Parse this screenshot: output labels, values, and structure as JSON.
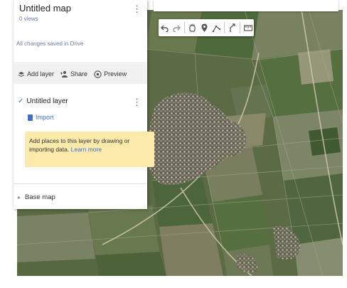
{
  "map": {
    "title": "Untitled map",
    "views": "0 views",
    "save_status": "All changes saved in Drive"
  },
  "actions": {
    "add_layer": "Add layer",
    "share": "Share",
    "preview": "Preview"
  },
  "layer": {
    "name": "Untitled layer",
    "import_label": "Import",
    "hint": "Add places to this layer by drawing or importing data.",
    "learn_more": "Learn more"
  },
  "base_map": {
    "label": "Base map"
  },
  "toolbar": {
    "icons": [
      "undo-icon",
      "redo-icon",
      "hand-icon",
      "marker-icon",
      "draw-line-icon",
      "route-icon",
      "ruler-icon"
    ]
  },
  "colors": {
    "link": "#3d6fd1",
    "hint_bg": "#fbeaa9",
    "meta_text": "#6b7fa8"
  }
}
